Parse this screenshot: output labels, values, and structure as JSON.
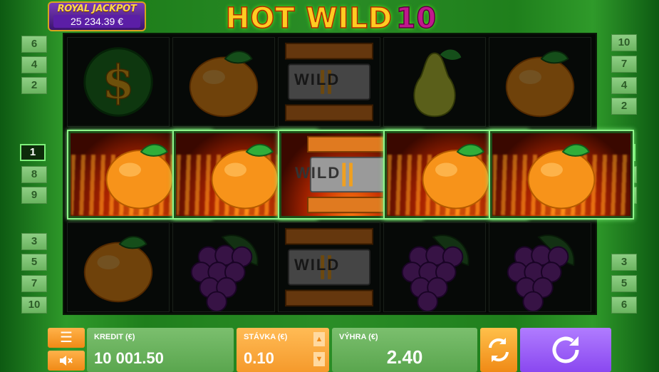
{
  "jackpot": {
    "title": "ROYAL JACKPOT",
    "value": "25 234.39 €"
  },
  "logo": {
    "text": "HOT WILD",
    "number": "10"
  },
  "paylines_left": [
    "6",
    "4",
    "2",
    "1",
    "8",
    "9",
    "3",
    "5",
    "7",
    "10"
  ],
  "paylines_right": [
    "10",
    "7",
    "4",
    "2",
    "1",
    "8",
    "9",
    "3",
    "5",
    "6"
  ],
  "active_payline": "1",
  "reels": {
    "grid": [
      [
        "dollar",
        "orange",
        "wild",
        "pear",
        "orange"
      ],
      [
        "orange",
        "orange",
        "wild",
        "orange",
        "orange"
      ],
      [
        "orange",
        "grapes",
        "wild",
        "grapes",
        "grapes"
      ]
    ],
    "winning_row": 1,
    "wild_label": "WILD"
  },
  "bottom": {
    "credit_label": "KREDIT (€)",
    "credit_value": "10 001.50",
    "bet_label": "STÁVKA (€)",
    "bet_value": "0.10",
    "win_label": "VÝHRA (€)",
    "win_value": "2.40"
  },
  "colors": {
    "accent_orange": "#f59a2c",
    "panel_green": "#6bb460",
    "spin_purple": "#9a5cf7",
    "win_highlight": "#8ef58a"
  }
}
